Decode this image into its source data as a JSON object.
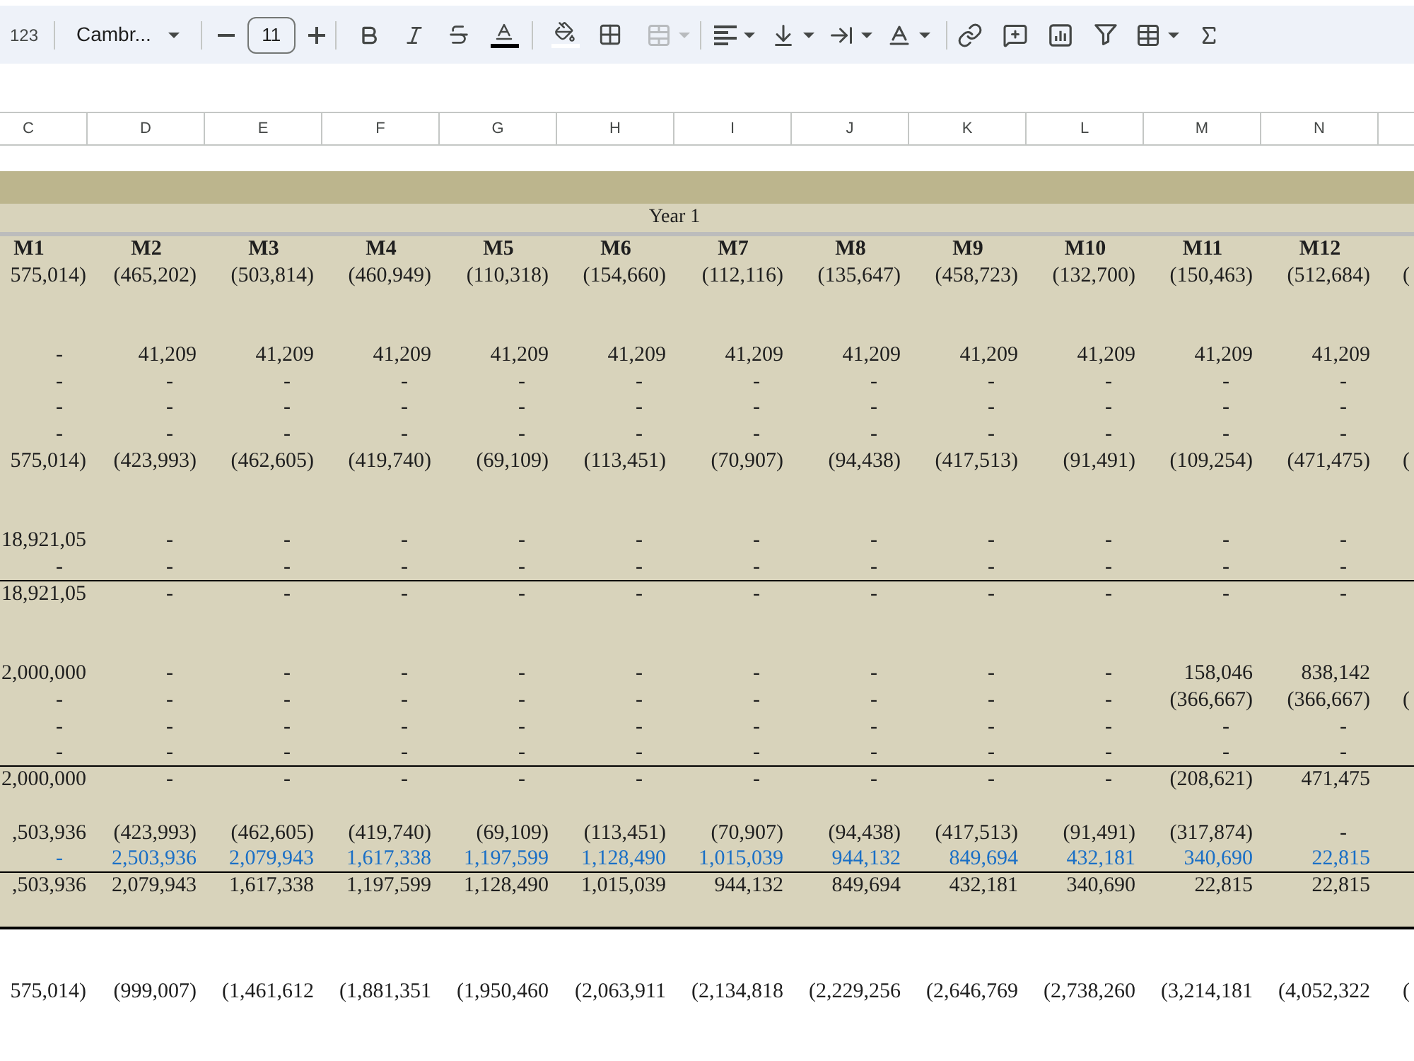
{
  "toolbar": {
    "number_format": "123",
    "font": "Cambr...",
    "font_size": "11",
    "merge": {
      "disabled": true
    }
  },
  "column_letters": [
    "C",
    "D",
    "E",
    "F",
    "G",
    "H",
    "I",
    "J",
    "K",
    "L",
    "M",
    "N"
  ],
  "sheet": {
    "period": "Year 1",
    "rows": [
      {
        "kind": "header",
        "rule_below": false,
        "cells": [
          "M1",
          "M2",
          "M3",
          "M4",
          "M5",
          "M6",
          "M7",
          "M8",
          "M9",
          "M10",
          "M11",
          "M12"
        ]
      },
      {
        "kind": "values",
        "rule_below": false,
        "cells": [
          "575,014)",
          "(465,202)",
          "(503,814)",
          "(460,949)",
          "(110,318)",
          "(154,660)",
          "(112,116)",
          "(135,647)",
          "(458,723)",
          "(132,700)",
          "(150,463)",
          "(512,684)",
          "("
        ]
      },
      {
        "kind": "blank",
        "rule_below": false
      },
      {
        "kind": "blank",
        "rule_below": false
      },
      {
        "kind": "values",
        "rule_below": false,
        "cells": [
          "-",
          "41,209",
          "41,209",
          "41,209",
          "41,209",
          "41,209",
          "41,209",
          "41,209",
          "41,209",
          "41,209",
          "41,209",
          "41,209"
        ]
      },
      {
        "kind": "values",
        "rule_below": false,
        "cells": [
          "-",
          "-",
          "-",
          "-",
          "-",
          "-",
          "-",
          "-",
          "-",
          "-",
          "-",
          "-"
        ]
      },
      {
        "kind": "values",
        "rule_below": false,
        "cells": [
          "-",
          "-",
          "-",
          "-",
          "-",
          "-",
          "-",
          "-",
          "-",
          "-",
          "-",
          "-"
        ]
      },
      {
        "kind": "values",
        "rule_below": false,
        "cells": [
          "-",
          "-",
          "-",
          "-",
          "-",
          "-",
          "-",
          "-",
          "-",
          "-",
          "-",
          "-"
        ]
      },
      {
        "kind": "values",
        "rule_below": false,
        "cells": [
          "575,014)",
          "(423,993)",
          "(462,605)",
          "(419,740)",
          "(69,109)",
          "(113,451)",
          "(70,907)",
          "(94,438)",
          "(417,513)",
          "(91,491)",
          "(109,254)",
          "(471,475)",
          "("
        ]
      },
      {
        "kind": "blank",
        "rule_below": false
      },
      {
        "kind": "blank",
        "rule_below": false
      },
      {
        "kind": "values",
        "rule_below": false,
        "cells": [
          "18,921,05",
          "-",
          "-",
          "-",
          "-",
          "-",
          "-",
          "-",
          "-",
          "-",
          "-",
          "-"
        ]
      },
      {
        "kind": "values",
        "rule_below": true,
        "cells": [
          "-",
          "-",
          "-",
          "-",
          "-",
          "-",
          "-",
          "-",
          "-",
          "-",
          "-",
          "-"
        ]
      },
      {
        "kind": "values",
        "rule_below": false,
        "cells": [
          "18,921,05",
          "-",
          "-",
          "-",
          "-",
          "-",
          "-",
          "-",
          "-",
          "-",
          "-",
          "-"
        ]
      },
      {
        "kind": "blank",
        "rule_below": false
      },
      {
        "kind": "blank",
        "rule_below": false
      },
      {
        "kind": "values",
        "rule_below": false,
        "cells": [
          "2,000,000",
          "-",
          "-",
          "-",
          "-",
          "-",
          "-",
          "-",
          "-",
          "-",
          "158,046",
          "838,142"
        ]
      },
      {
        "kind": "values",
        "rule_below": false,
        "cells": [
          "-",
          "-",
          "-",
          "-",
          "-",
          "-",
          "-",
          "-",
          "-",
          "-",
          "(366,667)",
          "(366,667)",
          "("
        ]
      },
      {
        "kind": "values",
        "rule_below": false,
        "cells": [
          "-",
          "-",
          "-",
          "-",
          "-",
          "-",
          "-",
          "-",
          "-",
          "-",
          "-",
          "-"
        ]
      },
      {
        "kind": "values",
        "rule_below": true,
        "cells": [
          "-",
          "-",
          "-",
          "-",
          "-",
          "-",
          "-",
          "-",
          "-",
          "-",
          "-",
          "-"
        ]
      },
      {
        "kind": "values",
        "rule_below": false,
        "cells": [
          "2,000,000",
          "-",
          "-",
          "-",
          "-",
          "-",
          "-",
          "-",
          "-",
          "-",
          "(208,621)",
          "471,475"
        ]
      },
      {
        "kind": "blank",
        "rule_below": false
      },
      {
        "kind": "values",
        "rule_below": false,
        "cells": [
          ",503,936",
          "(423,993)",
          "(462,605)",
          "(419,740)",
          "(69,109)",
          "(113,451)",
          "(70,907)",
          "(94,438)",
          "(417,513)",
          "(91,491)",
          "(317,874)",
          "-"
        ]
      },
      {
        "kind": "linked",
        "rule_below": true,
        "cells": [
          "-",
          "2,503,936",
          "2,079,943",
          "1,617,338",
          "1,197,599",
          "1,128,490",
          "1,015,039",
          "944,132",
          "849,694",
          "432,181",
          "340,690",
          "22,815"
        ]
      },
      {
        "kind": "values",
        "rule_below": false,
        "cells": [
          ",503,936",
          "2,079,943",
          "1,617,338",
          "1,197,599",
          "1,128,490",
          "1,015,039",
          "944,132",
          "849,694",
          "432,181",
          "340,690",
          "22,815",
          "22,815"
        ]
      },
      {
        "kind": "blank",
        "rule_below": false
      }
    ],
    "below": {
      "cells": [
        "575,014)",
        "(999,007)",
        "(1,461,612",
        "(1,881,351",
        "(1,950,460",
        "(2,063,911",
        "(2,134,818",
        "(2,229,256",
        "(2,646,769",
        "(2,738,260",
        "(3,214,181",
        "(4,052,322",
        "("
      ]
    }
  }
}
